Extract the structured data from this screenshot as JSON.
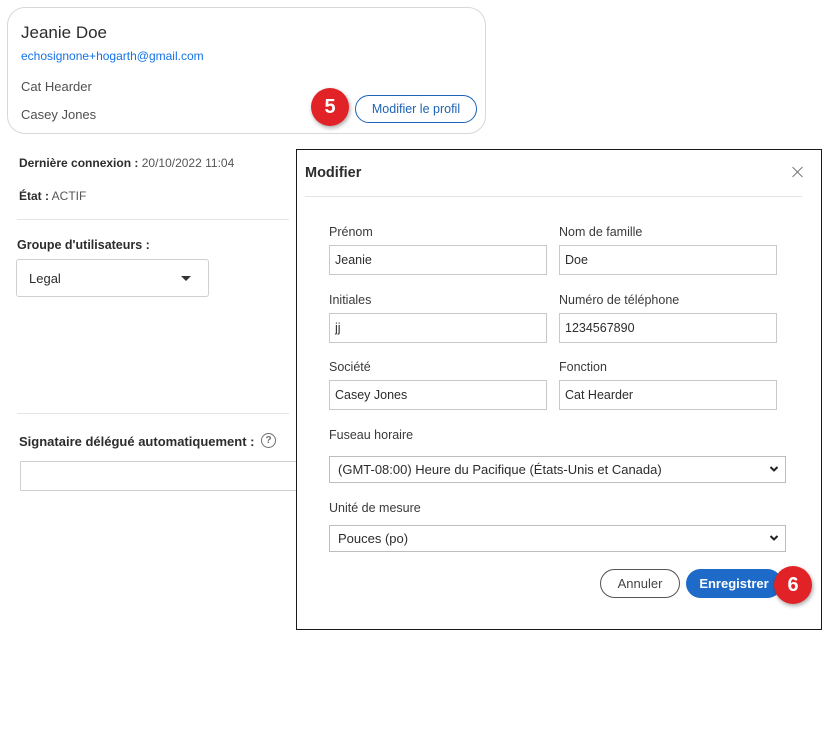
{
  "profile_card": {
    "name": "Jeanie Doe",
    "email": "echosignone+hogarth@gmail.com",
    "title": "Cat Hearder",
    "company": "Casey Jones",
    "edit_button_label": "Modifier le profil",
    "step_badge": "5"
  },
  "account_info": {
    "last_login_label": "Dernière connexion :",
    "last_login_value": "20/10/2022 11:04",
    "state_label": "État :",
    "state_value": "ACTIF"
  },
  "user_group": {
    "label": "Groupe d'utilisateurs :",
    "selected": "Legal"
  },
  "auto_delegate": {
    "label": "Signataire délégué automatiquement :",
    "help_icon": "?",
    "value": ""
  },
  "modal": {
    "title": "Modifier",
    "close_icon": "close-icon",
    "fields": {
      "first_name": {
        "label": "Prénom",
        "value": "Jeanie"
      },
      "last_name": {
        "label": "Nom de famille",
        "value": "Doe"
      },
      "initials": {
        "label": "Initiales",
        "value": "jj"
      },
      "phone": {
        "label": "Numéro de téléphone",
        "value": "1234567890"
      },
      "company": {
        "label": "Société",
        "value": "Casey Jones"
      },
      "job_title": {
        "label": "Fonction",
        "value": "Cat Hearder"
      },
      "timezone": {
        "label": "Fuseau horaire",
        "selected": "(GMT-08:00) Heure du Pacifique (États-Unis et Canada)"
      },
      "unit": {
        "label": "Unité de mesure",
        "selected": "Pouces (po)"
      }
    },
    "cancel_label": "Annuler",
    "save_label": "Enregistrer",
    "step_badge": "6"
  },
  "colors": {
    "accent_blue": "#1d6ac9",
    "link_blue": "#1473e6",
    "badge_red": "#e12227"
  }
}
